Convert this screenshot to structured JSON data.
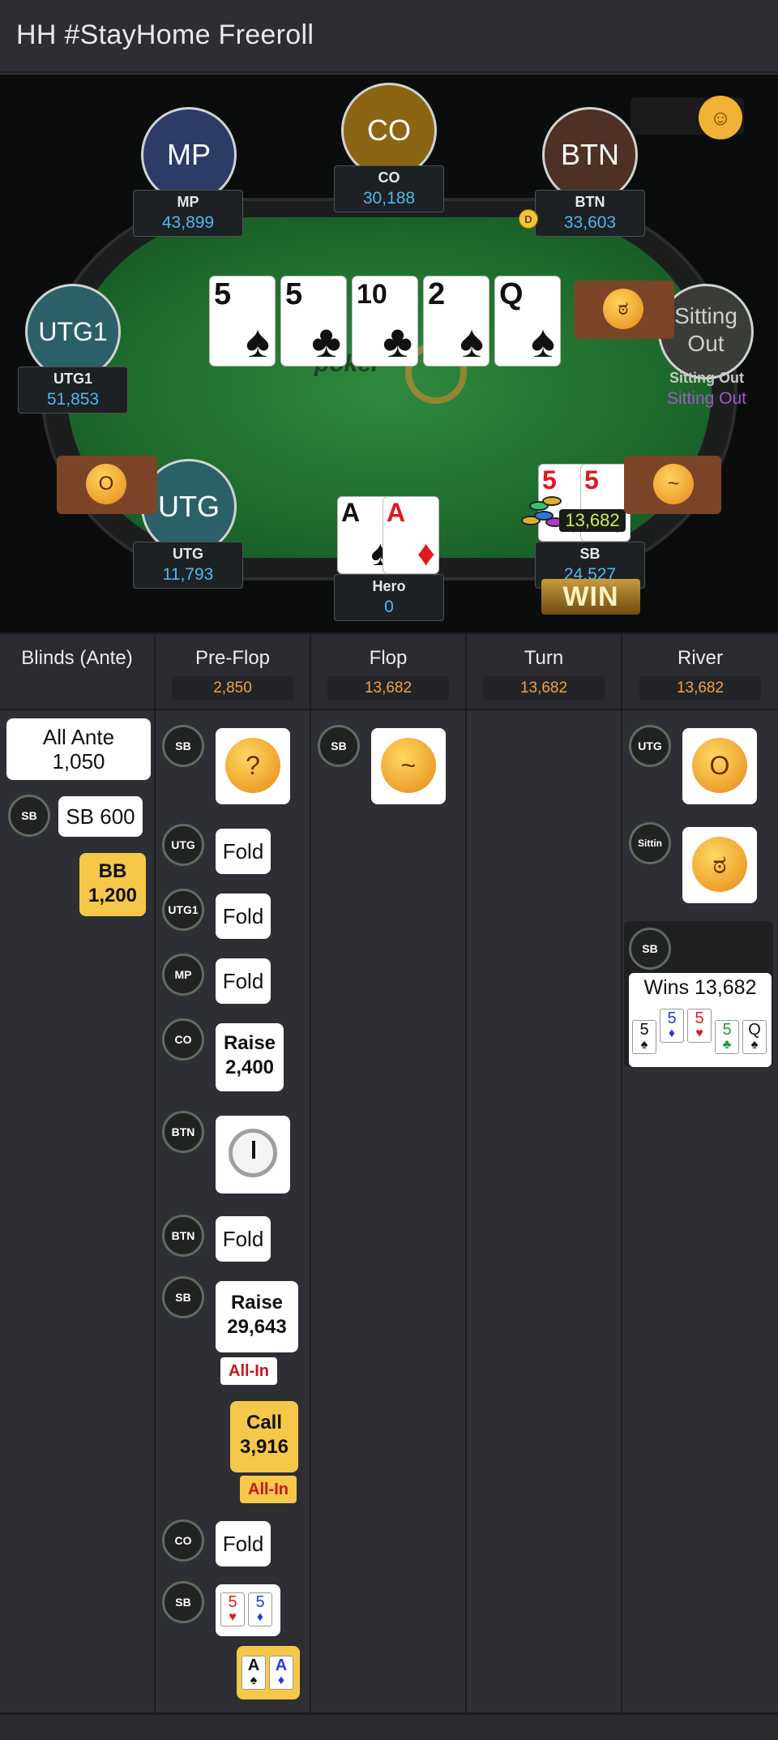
{
  "header": {
    "title": "HH  #StayHome Freeroll"
  },
  "table": {
    "brand": "poker",
    "seats": {
      "mp": {
        "avatar": "MP",
        "name": "MP",
        "stack": "43,899"
      },
      "co": {
        "avatar": "CO",
        "name": "CO",
        "stack": "30,188"
      },
      "btn": {
        "avatar": "BTN",
        "name": "BTN",
        "stack": "33,603"
      },
      "utg1": {
        "avatar": "UTG1",
        "name": "UTG1",
        "stack": "51,853"
      },
      "sitout": {
        "avatar_line1": "Sitting",
        "avatar_line2": "Out",
        "name": "Sitting Out",
        "stack": "Sitting Out"
      },
      "utg": {
        "avatar": "UTG",
        "name": "UTG",
        "stack": "11,793"
      },
      "hero": {
        "name": "Hero",
        "stack": "0"
      },
      "sb": {
        "name": "SB",
        "stack": "24,527"
      }
    },
    "dealer_button": "D",
    "board": [
      {
        "rank": "5",
        "suit": "♠"
      },
      {
        "rank": "5",
        "suit": "♣"
      },
      {
        "rank": "10",
        "suit": "♣"
      },
      {
        "rank": "2",
        "suit": "♠"
      },
      {
        "rank": "Q",
        "suit": "♠"
      }
    ],
    "hero_cards": [
      {
        "rank": "A",
        "suit": "♠"
      },
      {
        "rank": "A",
        "suit": "♦"
      }
    ],
    "sb_cards": [
      {
        "rank": "5",
        "suit": "♥"
      },
      {
        "rank": "5",
        "suit": "♦"
      }
    ],
    "pot": "13,682",
    "win_label": "WIN"
  },
  "streets": [
    {
      "name": "Blinds (Ante)",
      "pot": ""
    },
    {
      "name": "Pre-Flop",
      "pot": "2,850"
    },
    {
      "name": "Flop",
      "pot": "13,682"
    },
    {
      "name": "Turn",
      "pot": "13,682"
    },
    {
      "name": "River",
      "pot": "13,682"
    }
  ],
  "blinds": {
    "ante_l1": "All Ante",
    "ante_l2": "1,050",
    "sb_badge": "SB",
    "sb_action": "SB 600",
    "bb_l1": "BB",
    "bb_l2": "1,200"
  },
  "preflop": {
    "a1_badge": "SB",
    "a2_badge": "UTG",
    "a2_action": "Fold",
    "a3_badge": "UTG1",
    "a3_action": "Fold",
    "a4_badge": "MP",
    "a4_action": "Fold",
    "a5_badge": "CO",
    "a5_l1": "Raise",
    "a5_l2": "2,400",
    "a6_badge": "BTN",
    "a7_badge": "BTN",
    "a7_action": "Fold",
    "a8_badge": "SB",
    "a8_l1": "Raise",
    "a8_l2": "29,643",
    "a8_tag": "All-In",
    "hero_l1": "Call",
    "hero_l2": "3,916",
    "hero_tag": "All-In",
    "a10_badge": "CO",
    "a10_action": "Fold",
    "a11_badge": "SB",
    "a11_cards": [
      {
        "rank": "5",
        "suit": "♥"
      },
      {
        "rank": "5",
        "suit": "♦"
      }
    ],
    "hero_cards": [
      {
        "rank": "A",
        "suit": "♠"
      },
      {
        "rank": "A",
        "suit": "♦"
      }
    ]
  },
  "flop": {
    "a1_badge": "SB"
  },
  "river": {
    "a1_badge": "UTG",
    "a2_badge": "Sittin",
    "winner_badge": "SB",
    "wins_text": "Wins 13,682",
    "wins_cards": [
      {
        "rank": "5",
        "suit": "♠"
      },
      {
        "rank": "5",
        "suit": "♦"
      },
      {
        "rank": "5",
        "suit": "♥"
      },
      {
        "rank": "5",
        "suit": "♣"
      },
      {
        "rank": "Q",
        "suit": "♠"
      }
    ]
  },
  "colors": {
    "accent_blue": "#4fb8f0",
    "pot_orange": "#f0a24a",
    "allin_red": "#c6161c",
    "call_yellow": "#f6c84a"
  }
}
